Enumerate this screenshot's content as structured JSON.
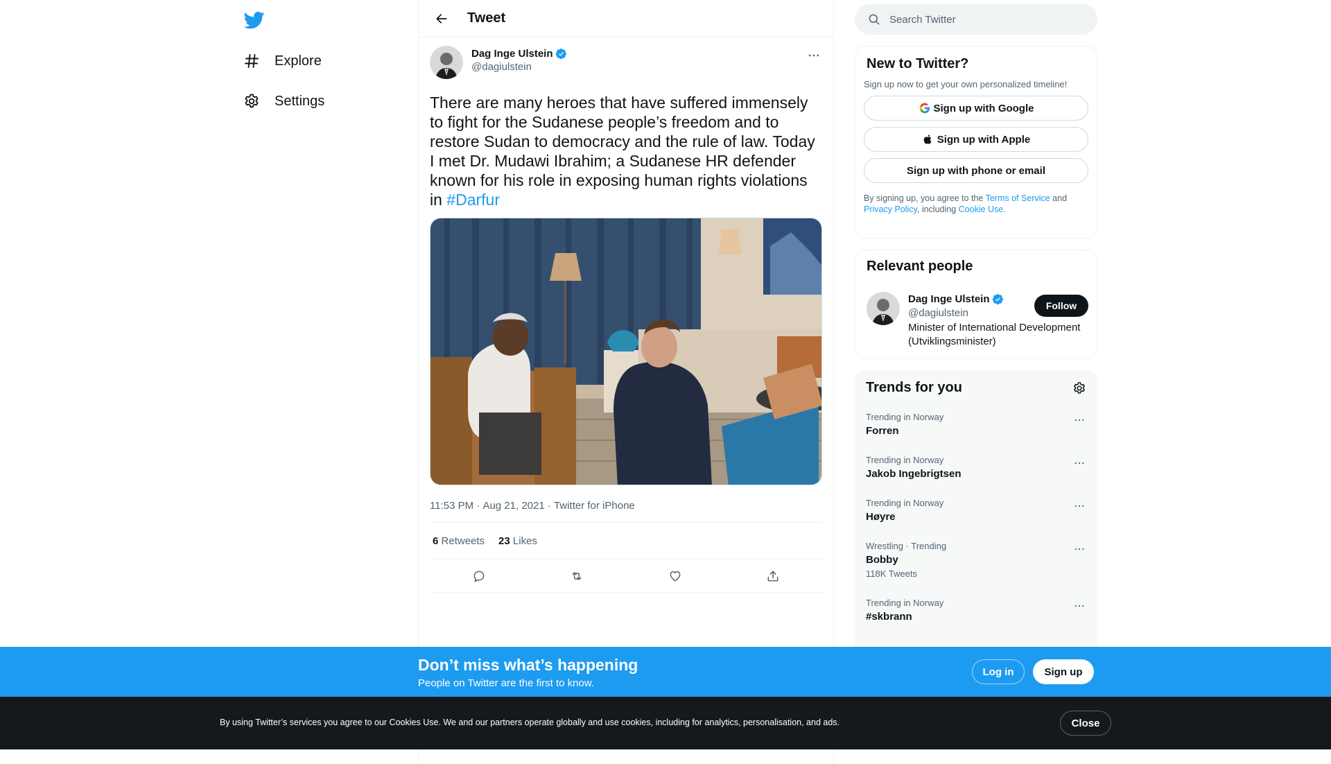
{
  "nav": {
    "items": [
      {
        "label": "Explore",
        "icon": "hashtag-icon"
      },
      {
        "label": "Settings",
        "icon": "gear-icon"
      }
    ]
  },
  "header": {
    "title": "Tweet"
  },
  "tweet": {
    "author_name": "Dag Inge Ulstein",
    "author_handle": "@dagiulstein",
    "text": "There are many heroes that have suffered immensely to fight for the Sudanese people’s freedom and to restore Sudan to democracy and the rule of law. Today I met Dr. Mudawi Ibrahim; a Sudanese HR defender known for his role in exposing human rights violations in",
    "hashtag": "#Darfur",
    "time": "11:53 PM",
    "date": "Aug 21, 2021",
    "source": "Twitter for iPhone",
    "separator": " · ",
    "retweets_count": "6",
    "retweets_label": "Retweets",
    "likes_count": "23",
    "likes_label": "Likes"
  },
  "search": {
    "placeholder": "Search Twitter"
  },
  "signup_card": {
    "title": "New to Twitter?",
    "subtitle": "Sign up now to get your own personalized timeline!",
    "google": "Sign up with Google",
    "apple": "Sign up with Apple",
    "phone": "Sign up with phone or email",
    "legal_1": "By signing up, you agree to the ",
    "terms": "Terms of Service",
    "legal_2": " and ",
    "privacy": "Privacy Policy",
    "legal_3": ", including ",
    "cookie": "Cookie Use."
  },
  "people_card": {
    "title": "Relevant people",
    "name": "Dag Inge Ulstein",
    "handle": "@dagiulstein",
    "bio": "Minister of International Development (Utviklingsminister)",
    "follow": "Follow"
  },
  "trends_card": {
    "title": "Trends for you",
    "items": [
      {
        "context": "Trending in Norway",
        "name": "Forren",
        "count": ""
      },
      {
        "context": "Trending in Norway",
        "name": "Jakob Ingebrigtsen",
        "count": ""
      },
      {
        "context": "Trending in Norway",
        "name": "Høyre",
        "count": ""
      },
      {
        "context": "Wrestling · Trending",
        "name": "Bobby",
        "count": "118K Tweets"
      },
      {
        "context": "Trending in Norway",
        "name": "#skbrann",
        "count": ""
      }
    ]
  },
  "banner": {
    "title": "Don’t miss what’s happening",
    "subtitle": "People on Twitter are the first to know.",
    "login": "Log in",
    "signup": "Sign up"
  },
  "cookie_bar": {
    "text": "By using Twitter’s services you agree to our Cookies Use. We and our partners operate globally and use cookies, including for analytics, personalisation, and ads.",
    "close": "Close"
  },
  "colors": {
    "brand": "#1d9bf0",
    "text": "#0f1419",
    "secondary": "#536471",
    "cookie_bg": "#16191c"
  }
}
